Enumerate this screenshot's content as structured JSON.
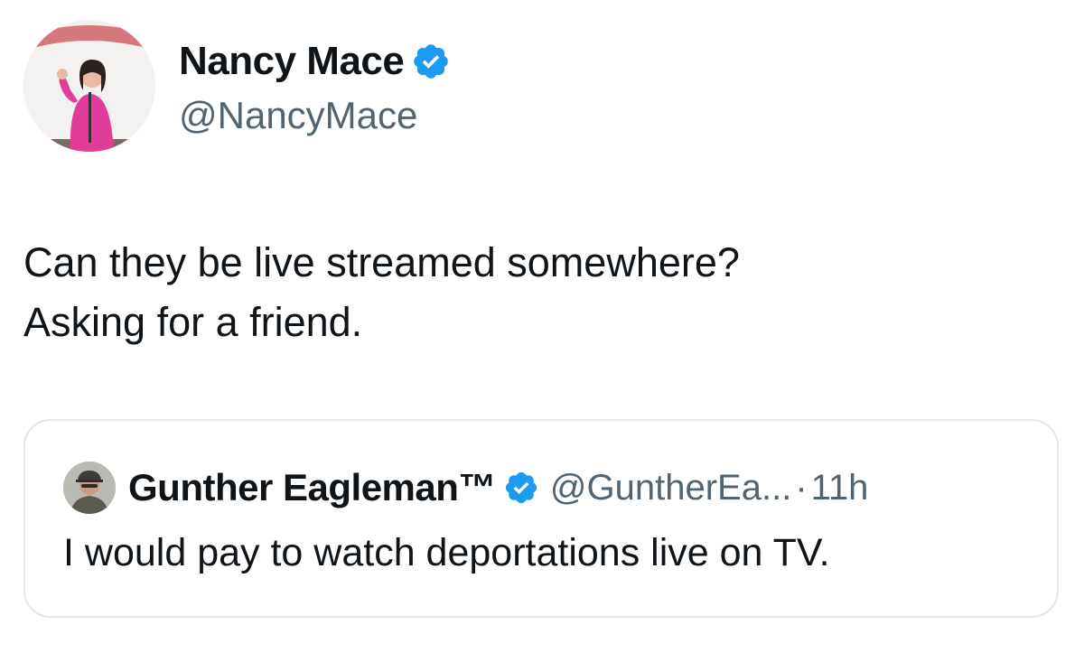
{
  "author": {
    "display_name": "Nancy Mace",
    "handle": "@NancyMace",
    "verified": true,
    "avatar_icon": "profile-photo"
  },
  "tweet": {
    "lines": [
      "Can they be live streamed somewhere?",
      "Asking for a friend."
    ]
  },
  "quoted_tweet": {
    "display_name": "Gunther Eagleman™",
    "handle": "@GuntherEa...",
    "separator": "·",
    "time": "11h",
    "verified": true,
    "text": "I would pay to watch deportations live on TV."
  },
  "colors": {
    "verified_blue": "#1d9bf0",
    "secondary_text": "#536471",
    "primary_text": "#0f1419",
    "border": "#e3e6e9"
  }
}
